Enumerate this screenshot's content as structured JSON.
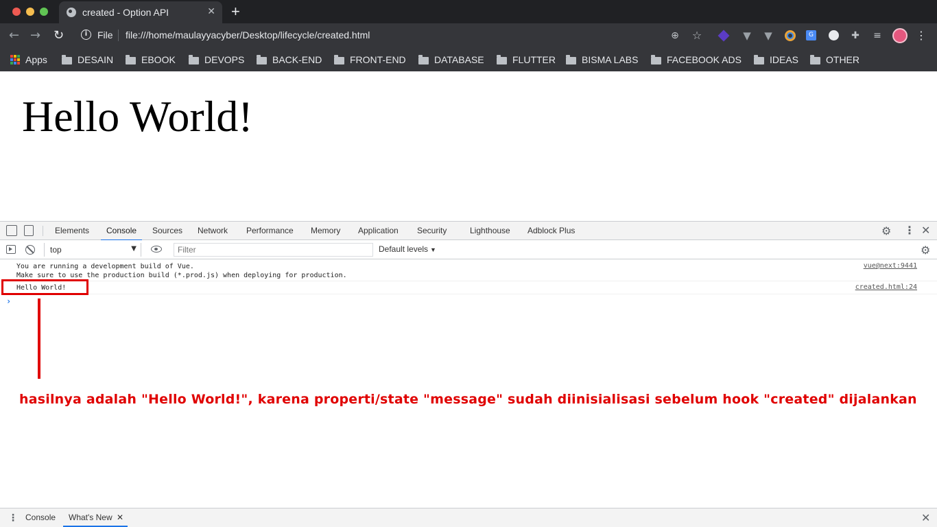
{
  "browser": {
    "tab_title": "created - Option API",
    "tab_close_glyph": "✕",
    "new_tab_glyph": "+",
    "address_scheme_label": "File",
    "address_url": "file:///home/maulayyacyber/Desktop/lifecycle/created.html",
    "icons": [
      "back-arrow-icon",
      "forward-arrow-icon",
      "reload-icon",
      "info-icon",
      "zoom-icon",
      "star-icon",
      "extension-icon",
      "puzzle-icon",
      "media-icon",
      "avatar",
      "menu-icon"
    ]
  },
  "bookmarks": {
    "apps_label": "Apps",
    "folders": [
      "DESAIN",
      "EBOOK",
      "DEVOPS",
      "BACK-END",
      "FRONT-END",
      "DATABASE",
      "FLUTTER",
      "BISMA LABS",
      "FACEBOOK ADS",
      "IDEAS",
      "OTHER"
    ]
  },
  "page": {
    "heading": "Hello World!"
  },
  "devtools": {
    "tabs": [
      "Elements",
      "Console",
      "Sources",
      "Network",
      "Performance",
      "Memory",
      "Application",
      "Security",
      "Lighthouse",
      "Adblock Plus"
    ],
    "active_tab": "Console",
    "context_label": "top",
    "filter_placeholder": "Filter",
    "levels_label": "Default levels",
    "console_messages": [
      {
        "text": "You are running a development build of Vue.\nMake sure to use the production build (*.prod.js) when deploying for production.",
        "source": "vue@next:9441"
      },
      {
        "text": "Hello World!",
        "source": "created.html:24"
      }
    ],
    "drawer_tabs": [
      "Console",
      "What's New"
    ],
    "drawer_active_tab": "What's New"
  },
  "annotation": {
    "text": "hasilnya adalah \"Hello World!\", karena properti/state \"message\" sudah diinisialisasi sebelum hook \"created\" dijalankan",
    "color": "#e00000"
  },
  "colors": {
    "chrome_dark": "#35363a",
    "tab_strip": "#202124",
    "devtools_accent": "#1a73e8"
  }
}
